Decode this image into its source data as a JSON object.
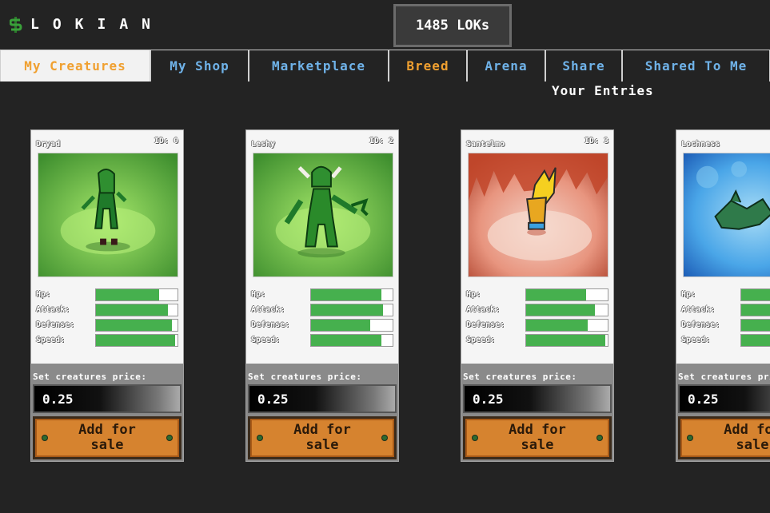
{
  "app": {
    "logo_text": "LOKIAN",
    "balance": "1485 LOKs",
    "logo_icon": "dollar-sign-icon"
  },
  "tabs": [
    {
      "label": "My Creatures",
      "color": "#f0a030",
      "active": true
    },
    {
      "label": "My Shop",
      "color": "#6fb2e8",
      "active": false
    },
    {
      "label": "Marketplace",
      "color": "#6fb2e8",
      "active": false
    },
    {
      "label": "Breed",
      "color": "#f0a030",
      "active": false
    },
    {
      "label": "Arena",
      "color": "#6fb2e8",
      "active": false
    },
    {
      "label": "Share",
      "color": "#6fb2e8",
      "active": false
    },
    {
      "label": "Shared To Me",
      "color": "#6fb2e8",
      "active": false
    }
  ],
  "entries_title": "Your Entries",
  "stat_labels": {
    "hp": "Hp:",
    "attack": "Attack:",
    "defense": "Defense:",
    "speed": "Speed:"
  },
  "price_label": "Set creatures price:",
  "add_button_label": "Add for sale",
  "creatures": [
    {
      "name": "Dryad",
      "id_text": "ID: 0",
      "price": "0.25",
      "stats": {
        "hp": 0.77,
        "attack": 0.88,
        "defense": 0.93,
        "speed": 0.97
      }
    },
    {
      "name": "Leshy",
      "id_text": "ID: 2",
      "price": "0.25",
      "stats": {
        "hp": 0.86,
        "attack": 0.88,
        "defense": 0.73,
        "speed": 0.86
      }
    },
    {
      "name": "Santelmo",
      "id_text": "ID: 3",
      "price": "0.25",
      "stats": {
        "hp": 0.74,
        "attack": 0.84,
        "defense": 0.75,
        "speed": 0.97
      }
    },
    {
      "name": "Lochness",
      "id_text": "",
      "price": "0.25",
      "stats": {
        "hp": 0.6,
        "attack": 0.6,
        "defense": 0.6,
        "speed": 0.6
      }
    }
  ]
}
